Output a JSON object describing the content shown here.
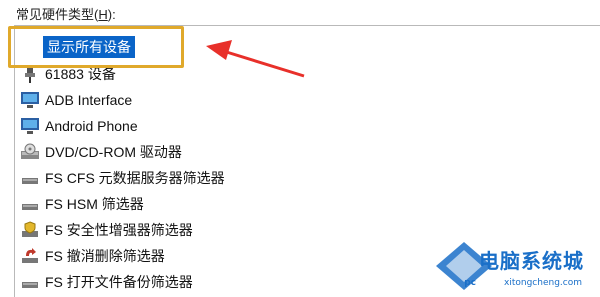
{
  "hardware_type_label": "常见硬件类型",
  "hardware_type_accel": "H",
  "device_list": {
    "selected": "显示所有设备",
    "items": [
      {
        "label": "61883 设备",
        "icon": "plug-icon"
      },
      {
        "label": "ADB Interface",
        "icon": "monitor-icon"
      },
      {
        "label": "Android Phone",
        "icon": "monitor-icon"
      },
      {
        "label": "DVD/CD-ROM 驱动器",
        "icon": "disc-drive-icon"
      },
      {
        "label": "FS CFS 元数据服务器筛选器",
        "icon": "drive-icon"
      },
      {
        "label": "FS HSM 筛选器",
        "icon": "drive-icon"
      },
      {
        "label": "FS 安全性增强器筛选器",
        "icon": "drive-shield-icon"
      },
      {
        "label": "FS 撤消删除筛选器",
        "icon": "undelete-icon"
      },
      {
        "label": "FS 打开文件备份筛选器",
        "icon": "drive-icon"
      }
    ]
  },
  "watermark": {
    "brand": "电脑系统城",
    "url": "xitongcheng.com",
    "pc": "pc"
  },
  "colors": {
    "highlight_box": "#e0a92b",
    "arrow": "#e8302a",
    "selection": "#0a64c8",
    "watermark": "#1a6fc8"
  }
}
